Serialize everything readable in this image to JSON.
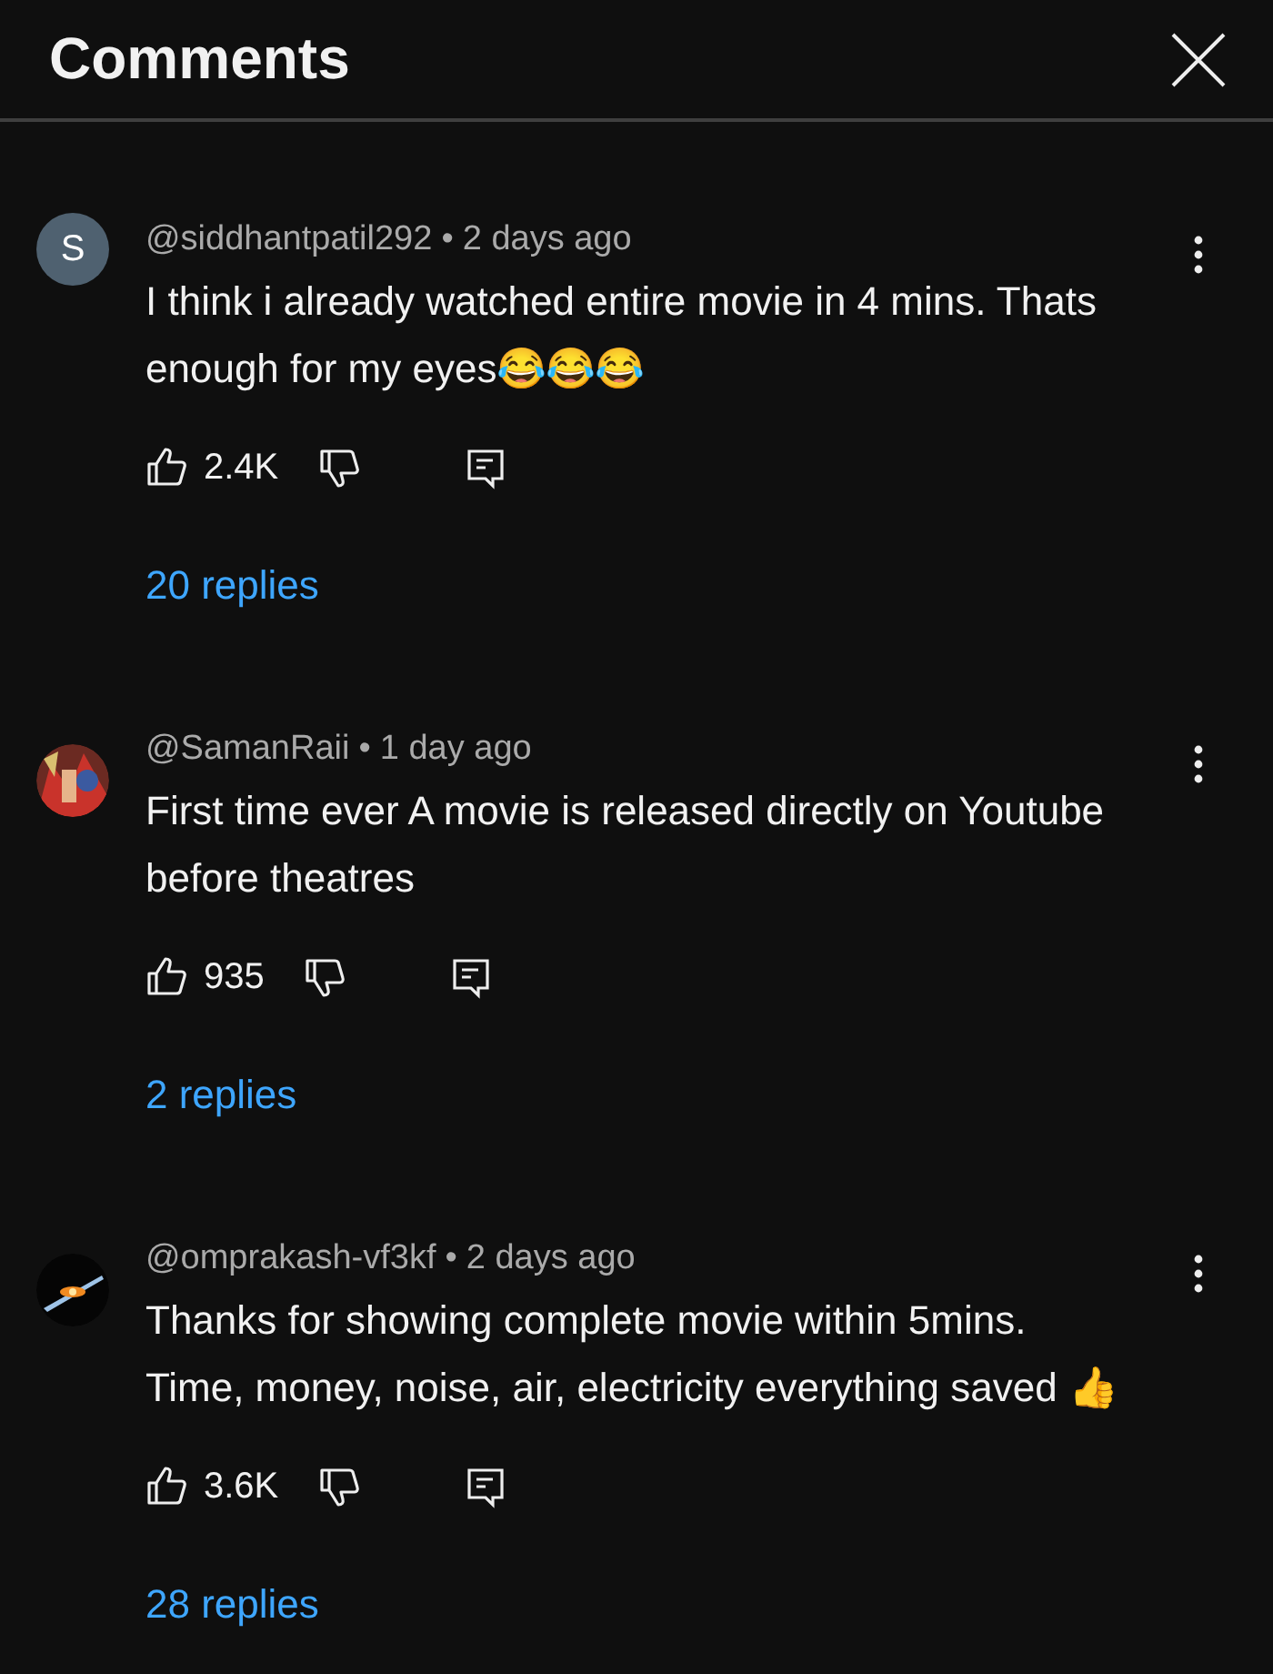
{
  "header": {
    "title": "Comments"
  },
  "comments": [
    {
      "avatar": {
        "kind": "letter",
        "letter": "S"
      },
      "author": "@siddhantpatil292",
      "separator": "•",
      "time": "2 days ago",
      "text": "I think i already watched entire movie in 4 mins. Thats enough for my eyes😂😂😂",
      "likes": "2.4K",
      "replies": "20 replies"
    },
    {
      "author": "@SamanRaii",
      "separator": "•",
      "time": "1 day ago",
      "text": "First time ever A movie is released directly on Youtube before theatres",
      "likes": "935",
      "replies": "2 replies"
    },
    {
      "author": "@omprakash-vf3kf",
      "separator": "•",
      "time": "2 days ago",
      "text": "Thanks for showing complete movie within 5mins. Time, money, noise, air, electricity everything saved 👍",
      "likes": "3.6K",
      "replies": "28 replies"
    }
  ]
}
